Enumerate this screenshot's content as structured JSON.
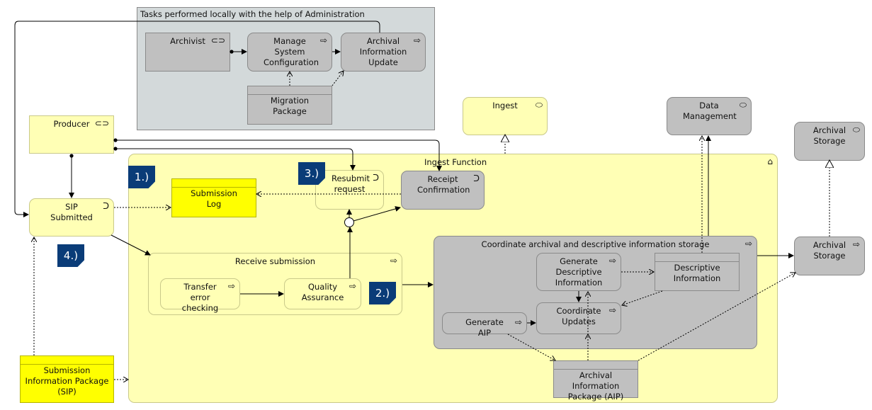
{
  "group": {
    "title": "Tasks performed locally with the help of Administration"
  },
  "nodes": {
    "archivist": "Archivist",
    "manage": "Manage System Configuration",
    "aiu": "Archival Information Update",
    "migration": "Migration Package",
    "ingest": "Ingest",
    "datamgmt": "Data Management",
    "storage_top": "Archival Storage",
    "producer": "Producer",
    "ingest_function": "Ingest Function",
    "submission_log": "Submission Log",
    "resubmit": "Resubmit request",
    "receipt": "Receipt Confirmation",
    "sip_submitted": "SIP Submitted",
    "receive": "Receive submission",
    "transfer": "Transfer error checking",
    "qa": "Quality Assurance",
    "coordinate": "Coordinate archival and descriptive information storage",
    "gen_desc": "Generate Descriptive Information",
    "desc_info": "Descriptive Information",
    "coord_updates": "Coordinate Updates",
    "gen_aip": "Generate AIP",
    "aip": "Archival Information Package (AIP)",
    "storage_right": "Archival Storage",
    "sip": "Submission Information Package (SIP)"
  },
  "badges": [
    "1.)",
    "2.)",
    "3.)",
    "4.)"
  ],
  "icons": {
    "role": "role-icon",
    "process": "process-arrow-icon",
    "event": "event-icon",
    "service": "service-icon",
    "function": "function-icon"
  },
  "colors": {
    "grey": "#c0c0c0",
    "yellow": "#ffffb5",
    "bright_yellow": "#ffff00",
    "badge": "#0a3c78",
    "group": "#d3d9da"
  }
}
